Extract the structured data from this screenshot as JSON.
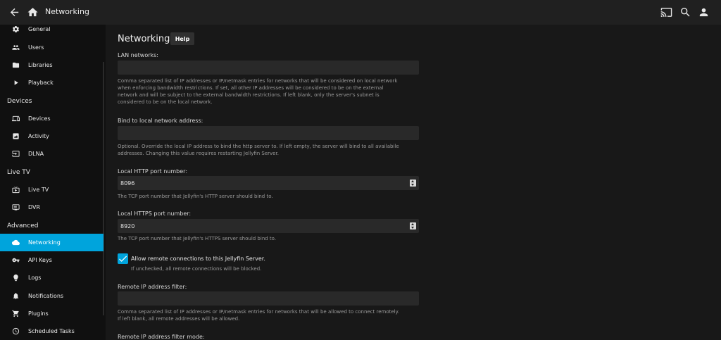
{
  "topbar": {
    "title": "Networking",
    "icons": [
      "back-arrow-icon",
      "home-icon",
      "cast-icon",
      "search-icon",
      "user-icon"
    ]
  },
  "sidebar": {
    "items_top": [
      {
        "label": "General",
        "icon": "gear-icon"
      },
      {
        "label": "Users",
        "icon": "users-icon"
      },
      {
        "label": "Libraries",
        "icon": "folder-icon"
      },
      {
        "label": "Playback",
        "icon": "play-icon"
      }
    ],
    "section_devices": "Devices",
    "items_devices": [
      {
        "label": "Devices",
        "icon": "devices-icon"
      },
      {
        "label": "Activity",
        "icon": "activity-icon"
      },
      {
        "label": "DLNA",
        "icon": "dlna-icon"
      }
    ],
    "section_livetv": "Live TV",
    "items_livetv": [
      {
        "label": "Live TV",
        "icon": "tv-icon"
      },
      {
        "label": "DVR",
        "icon": "dvr-icon"
      }
    ],
    "section_advanced": "Advanced",
    "items_advanced": [
      {
        "label": "Networking",
        "icon": "cloud-icon",
        "active": true
      },
      {
        "label": "API Keys",
        "icon": "key-icon"
      },
      {
        "label": "Logs",
        "icon": "logs-icon"
      },
      {
        "label": "Notifications",
        "icon": "bell-icon"
      },
      {
        "label": "Plugins",
        "icon": "cart-icon"
      },
      {
        "label": "Scheduled Tasks",
        "icon": "clock-icon"
      }
    ]
  },
  "accent_color": "#00a4dc",
  "main": {
    "title": "Networking",
    "help_label": "Help",
    "lan": {
      "label": "LAN networks:",
      "value": "",
      "description_lines": [
        "Comma separated list of IP addresses or IP/netmask entries for networks that will be considered on local network",
        "when enforcing bandwidth restrictions. If set, all other IP addresses will be considered to be on the external",
        "network and will be subject to the external bandwidth restrictions. If left blank, only the server's subnet is",
        "considered to be on the local network."
      ]
    },
    "bind": {
      "label": "Bind to local network address:",
      "value": "",
      "description_lines": [
        "Optional. Override the local IP address to bind the http server to. If left empty, the server will bind to all availabile",
        "addresses. Changing this value requires restarting Jellyfin Server."
      ]
    },
    "http_port": {
      "label": "Local HTTP port number:",
      "value": "8096",
      "description": "The TCP port number that Jellyfin's HTTP server should bind to."
    },
    "https_port": {
      "label": "Local HTTPS port number:",
      "value": "8920",
      "description": "The TCP port number that Jellyfin's HTTPS server should bind to."
    },
    "remote": {
      "label": "Allow remote connections to this Jellyfin Server.",
      "checked": true,
      "description": "If unchecked, all remote connections will be blocked."
    },
    "remote_filter": {
      "label": "Remote IP address filter:",
      "value": "",
      "description_lines": [
        "Comma separated list of IP addresses or IP/netmask entries for networks that will be allowed to connect remotely.",
        "If left blank, all remote addresses will be allowed."
      ]
    },
    "filter_mode": {
      "label": "Remote IP address filter mode:"
    }
  }
}
